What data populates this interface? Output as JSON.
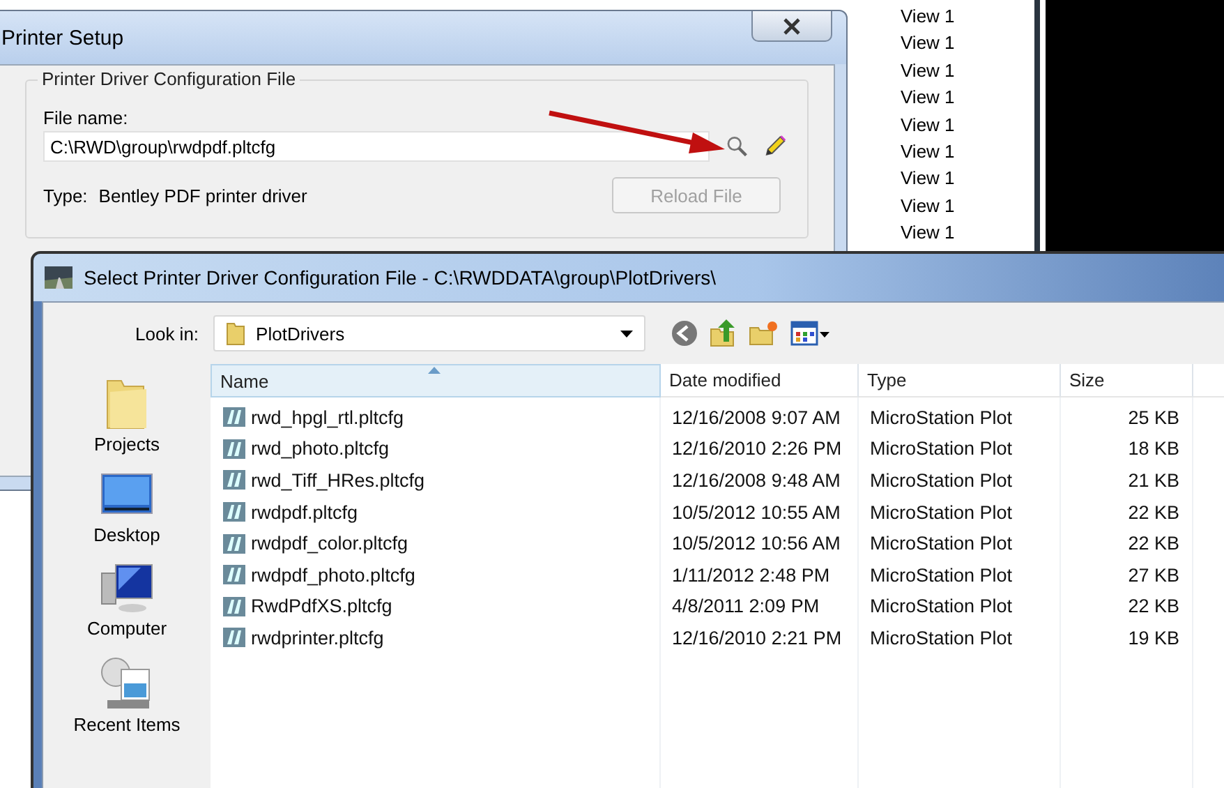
{
  "printer_setup": {
    "title": "Printer Setup",
    "group_title": "Printer Driver Configuration File",
    "file_label": "File name:",
    "file_value": "C:\\RWD\\group\\rwdpdf.pltcfg",
    "type_label": "Type:",
    "type_value": "Bentley PDF printer driver",
    "reload_button": {
      "label": "Reload File",
      "disabled": true
    }
  },
  "view_list": [
    "View 1",
    "View 1",
    "View 1",
    "View 1",
    "View 1",
    "View 1",
    "View 1",
    "View 1",
    "View 1"
  ],
  "select_dialog": {
    "title": "Select Printer Driver Configuration File - C:\\RWDDATA\\group\\PlotDrivers\\",
    "look_in_label": "Look in:",
    "look_in_value": "PlotDrivers",
    "places": [
      {
        "label": "Projects",
        "kind": "folder"
      },
      {
        "label": "Desktop",
        "kind": "desktop"
      },
      {
        "label": "Computer",
        "kind": "computer"
      },
      {
        "label": "Recent Items",
        "kind": "recent"
      }
    ],
    "columns": [
      {
        "label": "Name",
        "sorted": true
      },
      {
        "label": "Date modified",
        "sorted": false
      },
      {
        "label": "Type",
        "sorted": false
      },
      {
        "label": "Size",
        "sorted": false
      }
    ],
    "rows": [
      {
        "name": "rwd_hpgl_rtl.pltcfg",
        "date": "12/16/2008 9:07 AM",
        "type": "MicroStation Plot",
        "size": "25 KB"
      },
      {
        "name": "rwd_photo.pltcfg",
        "date": "12/16/2010 2:26 PM",
        "type": "MicroStation Plot",
        "size": "18 KB"
      },
      {
        "name": "rwd_Tiff_HRes.pltcfg",
        "date": "12/16/2008 9:48 AM",
        "type": "MicroStation Plot",
        "size": "21 KB"
      },
      {
        "name": "rwdpdf.pltcfg",
        "date": "10/5/2012 10:55 AM",
        "type": "MicroStation Plot",
        "size": "22 KB"
      },
      {
        "name": "rwdpdf_color.pltcfg",
        "date": "10/5/2012 10:56 AM",
        "type": "MicroStation Plot",
        "size": "22 KB"
      },
      {
        "name": "rwdpdf_photo.pltcfg",
        "date": "1/11/2012 2:48 PM",
        "type": "MicroStation Plot",
        "size": "27 KB"
      },
      {
        "name": "RwdPdfXS.pltcfg",
        "date": "4/8/2011 2:09 PM",
        "type": "MicroStation Plot",
        "size": "22 KB"
      },
      {
        "name": "rwdprinter.pltcfg",
        "date": "12/16/2010 2:21 PM",
        "type": "MicroStation Plot",
        "size": "19 KB"
      }
    ]
  }
}
